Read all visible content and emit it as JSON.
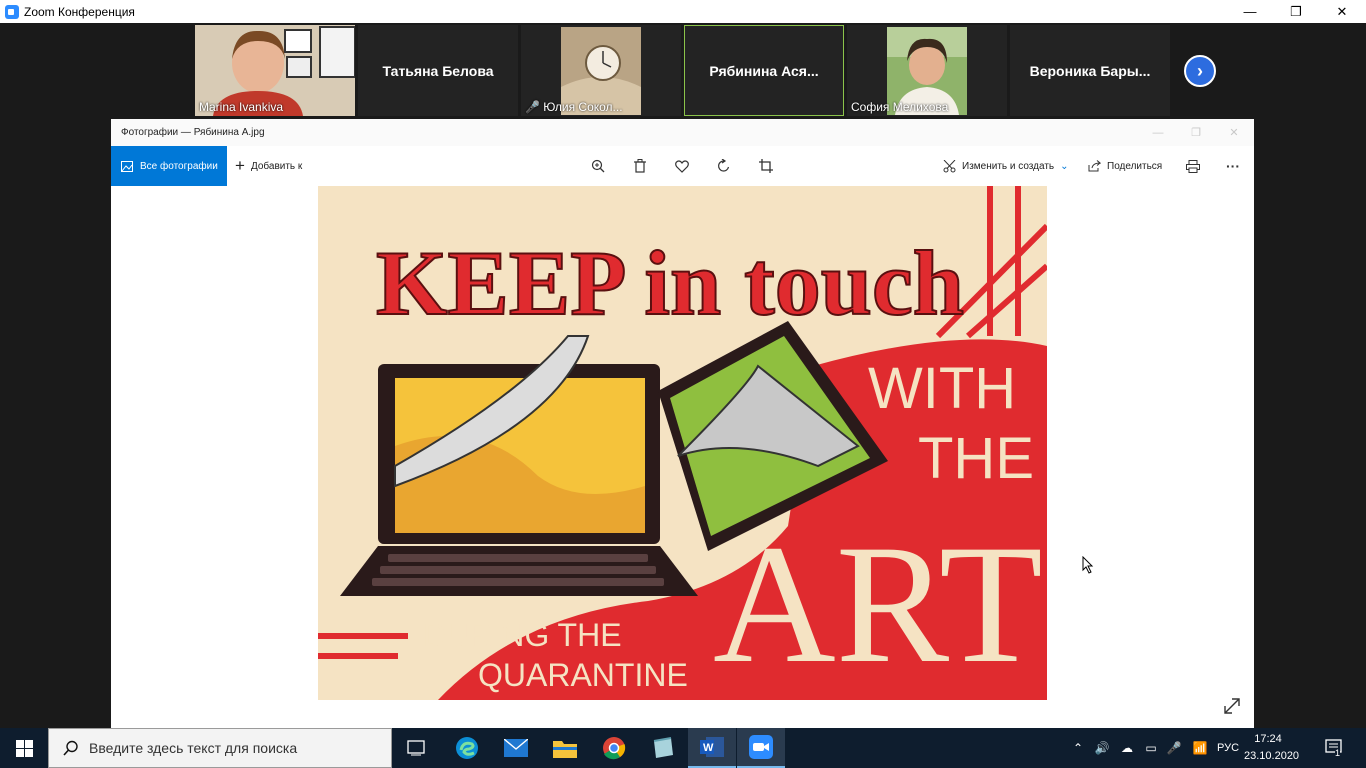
{
  "zoom": {
    "title": "Zoom Конференция",
    "controls": {
      "minimize": "—",
      "restore": "❐",
      "close": "✕"
    }
  },
  "participants": [
    {
      "label": "Marina Ivankiva"
    },
    {
      "name": "Татьяна Белова"
    },
    {
      "label": "Юлия Сокол...",
      "muted": true
    },
    {
      "name": "Рябинина  Ася..."
    },
    {
      "label": "София Мелихова"
    },
    {
      "name": "Вероника  Бары..."
    }
  ],
  "photos": {
    "title": "Фотографии — Рябинина А.jpg",
    "all_photos": "Все фотографии",
    "add_to": "Добавить к",
    "edit_create": "Изменить и создать",
    "share": "Поделиться",
    "more": "···"
  },
  "artwork": {
    "line1": "KEEP in touch",
    "line2a": "WITH",
    "line2b": "THE",
    "line3": "ART",
    "line4a": "DURING THE",
    "line4b": "QUARANTINE",
    "colors": {
      "cream": "#f5e3c3",
      "red": "#e02b2f",
      "yellow": "#f5c33b",
      "green": "#8fbf3f",
      "dark": "#2a1a1a"
    }
  },
  "taskbar": {
    "search_placeholder": "Введите здесь текст для поиска",
    "language": "РУС",
    "time": "17:24",
    "date": "23.10.2020",
    "notifications": "1"
  }
}
